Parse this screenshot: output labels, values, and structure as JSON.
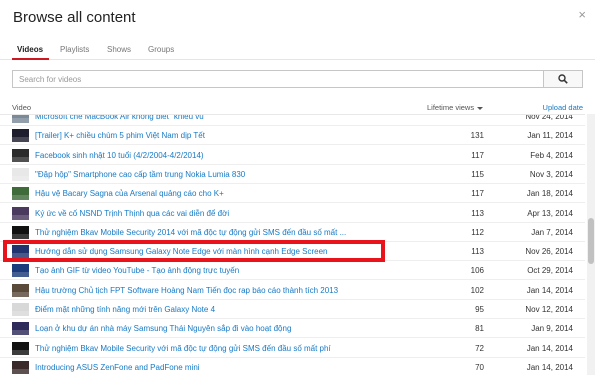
{
  "dialog": {
    "title": "Browse all content",
    "close_icon": "×"
  },
  "tabs": [
    {
      "label": "Videos",
      "active": true
    },
    {
      "label": "Playlists",
      "active": false
    },
    {
      "label": "Shows",
      "active": false
    },
    {
      "label": "Groups",
      "active": false
    }
  ],
  "search": {
    "placeholder": "Search for videos",
    "value": ""
  },
  "columns": {
    "video": "Video",
    "views": "Lifetime views",
    "date": "Upload date"
  },
  "rows": [
    {
      "title": "Microsoft chê MacBook Air không biết \"khiêu vũ\"",
      "views": "",
      "date": "Nov 24, 2014",
      "thumb": "#7a8a99"
    },
    {
      "title": "[Trailer] K+ chiều chùm 5 phim Việt Nam dịp Tết",
      "views": "131",
      "date": "Jan 11, 2014",
      "thumb": "#1d1d2e"
    },
    {
      "title": "Facebook sinh nhật 10 tuổi (4/2/2004-4/2/2014)",
      "views": "117",
      "date": "Feb 4, 2014",
      "thumb": "#2b2b2b"
    },
    {
      "title": "\"Đập hộp\" Smartphone cao cấp tầm trung Nokia Lumia 830",
      "views": "115",
      "date": "Nov 3, 2014",
      "thumb": "#e8e8e8"
    },
    {
      "title": "Hậu vệ Bacary Sagna của Arsenal quảng cáo cho K+",
      "views": "117",
      "date": "Jan 18, 2014",
      "thumb": "#3f6b3a"
    },
    {
      "title": "Ký ức về cố NSND Trịnh Thịnh qua các vai diễn để đời",
      "views": "113",
      "date": "Apr 13, 2014",
      "thumb": "#4a3a5e"
    },
    {
      "title": "Thử nghiệm Bkav Mobile Security 2014 với mã độc tự động gửi SMS đến đầu số mất ...",
      "views": "112",
      "date": "Jan 7, 2014",
      "thumb": "#111111"
    },
    {
      "title": "Hướng dẫn sử dụng Samsung Galaxy Note Edge với màn hình cạnh Edge Screen",
      "views": "113",
      "date": "Nov 26, 2014",
      "thumb": "#22346e"
    },
    {
      "title": "Tạo ảnh GIF từ video YouTube - Tạo ảnh động trực tuyến",
      "views": "106",
      "date": "Oct 29, 2014",
      "thumb": "#1a3c7a"
    },
    {
      "title": "Hậu trường Chủ tịch FPT Software Hoàng Nam Tiến đọc rap báo cáo thành tích 2013",
      "views": "102",
      "date": "Jan 14, 2014",
      "thumb": "#5a4a3a"
    },
    {
      "title": "Điểm mặt những tính năng mới trên Galaxy Note 4",
      "views": "95",
      "date": "Nov 12, 2014",
      "thumb": "#d8d8d8"
    },
    {
      "title": "Loạn ở khu dự án nhà máy Samsung Thái Nguyên sắp đi vào hoạt động",
      "views": "81",
      "date": "Jan 9, 2014",
      "thumb": "#2e2a5a"
    },
    {
      "title": "Thử nghiệm Bkav Mobile Security với mã độc tự động gửi SMS đến đầu số mất phí",
      "views": "72",
      "date": "Jan 14, 2014",
      "thumb": "#121212"
    },
    {
      "title": "Introducing ASUS ZenFone and PadFone mini",
      "views": "70",
      "date": "Jan 14, 2014",
      "thumb": "#3a2a2a"
    }
  ]
}
